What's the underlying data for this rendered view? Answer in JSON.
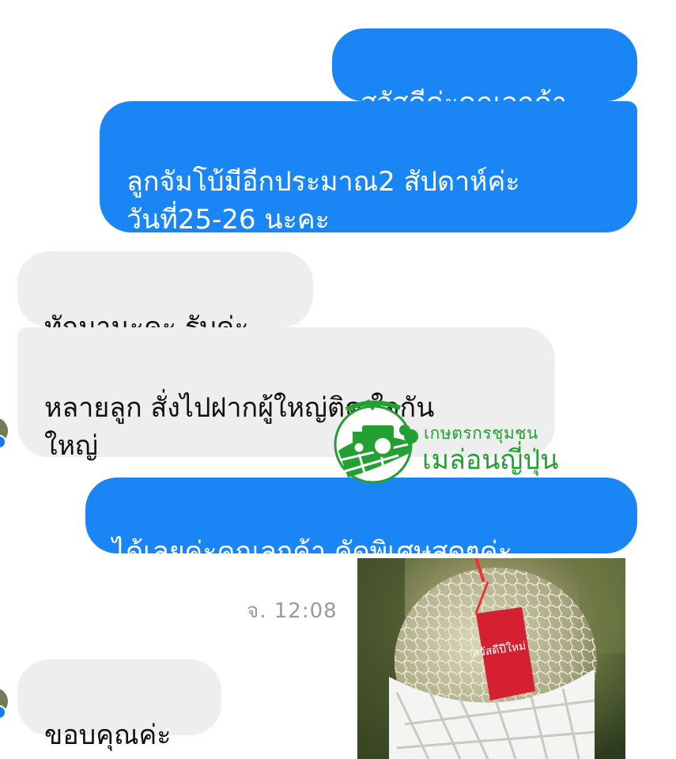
{
  "messages": [
    {
      "id": "m1",
      "side": "outgoing",
      "text": "สวัสดีค่ะคุณลูกค้า"
    },
    {
      "id": "m2",
      "side": "outgoing",
      "text": "ลูกจัมโบ้มีอีกประมาณ2 สัปดาห์ค่ะ\nวันที่25-26 นะคะ"
    },
    {
      "id": "m3",
      "side": "incoming",
      "text": "ทักมานะคะ รับค่ะ"
    },
    {
      "id": "m4",
      "side": "incoming",
      "text": "หลายลูก สั่งไปฝากผู้ใหญ่ติด ใจกัน\nใหญ่"
    },
    {
      "id": "m5",
      "side": "outgoing",
      "text": "ได้เลยค่ะคุณลูกค้า คัดพิเศษสุดๆค่ะ"
    },
    {
      "id": "m6",
      "side": "incoming",
      "text": "ขอบคุณค่ะ"
    }
  ],
  "timestamp": "จ. 12:08",
  "watermark": {
    "line1": "เกษตรกรชุมชน",
    "line2": "เมล่อนญี่ปุ่น"
  },
  "photo": {
    "description_tag_text": "สวัสดีปีใหม่"
  },
  "colors": {
    "outgoing_bubble": "#1a86f5",
    "incoming_bubble": "#eeeeee",
    "watermark_green": "#22a032"
  }
}
